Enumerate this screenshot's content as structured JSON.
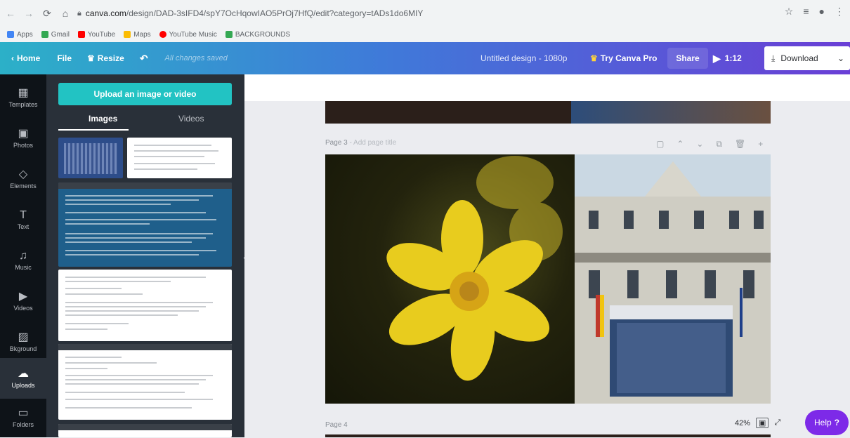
{
  "browser": {
    "url_domain": "canva.com",
    "url_path": "/design/DAD-3sIFD4/spY7OcHqowIAO5PrOj7HfQ/edit?category=tADs1do6MIY",
    "bookmarks": [
      "Apps",
      "Gmail",
      "YouTube",
      "Maps",
      "YouTube Music",
      "BACKGROUNDS"
    ]
  },
  "topbar": {
    "home": "Home",
    "file": "File",
    "resize": "Resize",
    "saved": "All changes saved",
    "title": "Untitled design - 1080p",
    "try_pro": "Try Canva Pro",
    "share": "Share",
    "play_time": "1:12",
    "download": "Download"
  },
  "rail": [
    {
      "label": "Templates",
      "icon": "template-icon"
    },
    {
      "label": "Photos",
      "icon": "photos-icon"
    },
    {
      "label": "Elements",
      "icon": "elements-icon"
    },
    {
      "label": "Text",
      "icon": "text-icon"
    },
    {
      "label": "Music",
      "icon": "music-icon"
    },
    {
      "label": "Videos",
      "icon": "videos-icon"
    },
    {
      "label": "Bkground",
      "icon": "background-icon"
    },
    {
      "label": "Uploads",
      "icon": "uploads-icon",
      "active": true
    },
    {
      "label": "Folders",
      "icon": "folders-icon"
    }
  ],
  "panel": {
    "upload_button": "Upload an image or video",
    "tabs": [
      "Images",
      "Videos"
    ],
    "active_tab": "Images"
  },
  "canvas": {
    "page3_label": "Page 3",
    "page3_sub": "- Add page title",
    "page4_label": "Page 4",
    "zoom": "42%",
    "help": "Help"
  },
  "colors": {
    "accent_teal": "#22c3c3",
    "accent_purple": "#7d2ae8"
  }
}
